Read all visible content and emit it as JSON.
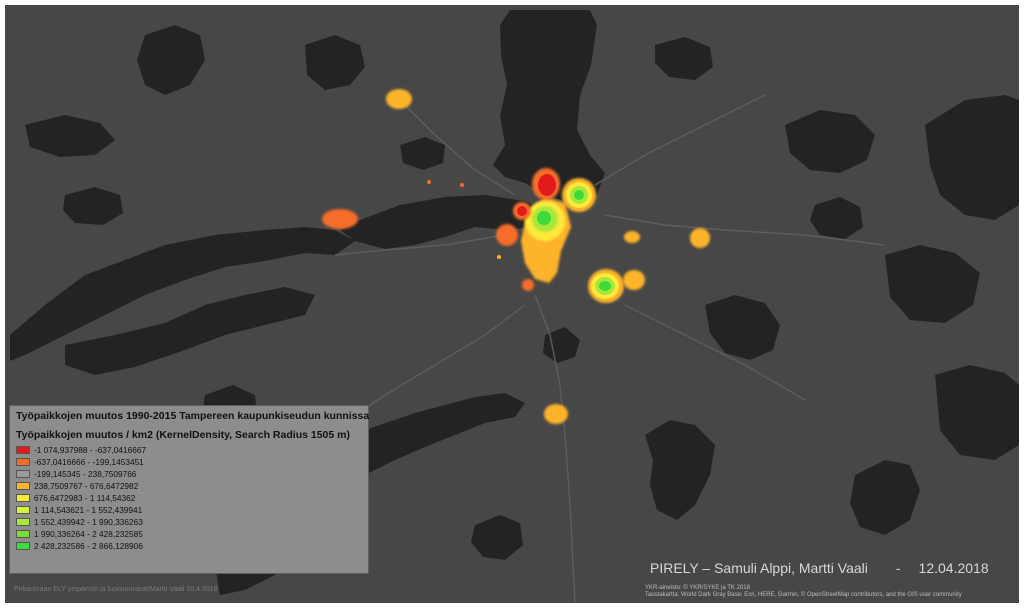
{
  "legend": {
    "title": "Työpaikkojen muutos 1990-2015 Tampereen kaupunkiseudun kunnissa",
    "subtitle": "Työpaikkojen muutos / km2 (KernelDensity, Search Radius 1505 m)",
    "items": [
      {
        "label": "-1 074,937988 - -637,0416667",
        "color": "#e31a1c"
      },
      {
        "label": "-637,0416666 - -199,1453451",
        "color": "#f46d2a"
      },
      {
        "label": "-199,145345 - 238,7509766",
        "color": "#9a9a9a"
      },
      {
        "label": "238,7509767 - 676,6472982",
        "color": "#fdb42c"
      },
      {
        "label": "676,6472983 - 1 114,54362",
        "color": "#ffe93a"
      },
      {
        "label": "1 114,543621 - 1 552,439941",
        "color": "#d9f23a"
      },
      {
        "label": "1 552,439942 - 1 990,336263",
        "color": "#a8e83a"
      },
      {
        "label": "1 990,336264 - 2 428,232585",
        "color": "#7bdc3a"
      },
      {
        "label": "2 428,232586 - 2 866,128906",
        "color": "#3ed93a"
      }
    ]
  },
  "credit": {
    "authors": "PIRELY – Samuli Alppi, Martti Vaali",
    "dash": "-",
    "date": "12.04.2018"
  },
  "footer": {
    "left": "Pirkanmaan ELY ympäristö ja luonnonvarat/Martti Vaali 10.4.2018",
    "attribution_line1": "YKR-aineisto: © YKR/SYKE ja TK 2018",
    "attribution_line2": "Taustakartta: World Dark Gray Base: Esri, HERE, Garmin, © OpenStreetMap contributors, and the GIS user community"
  },
  "colors": {
    "land": "#474747",
    "water": "#232323",
    "roads": "#5d5d5d",
    "legend_bg": "#8d8d8d"
  }
}
